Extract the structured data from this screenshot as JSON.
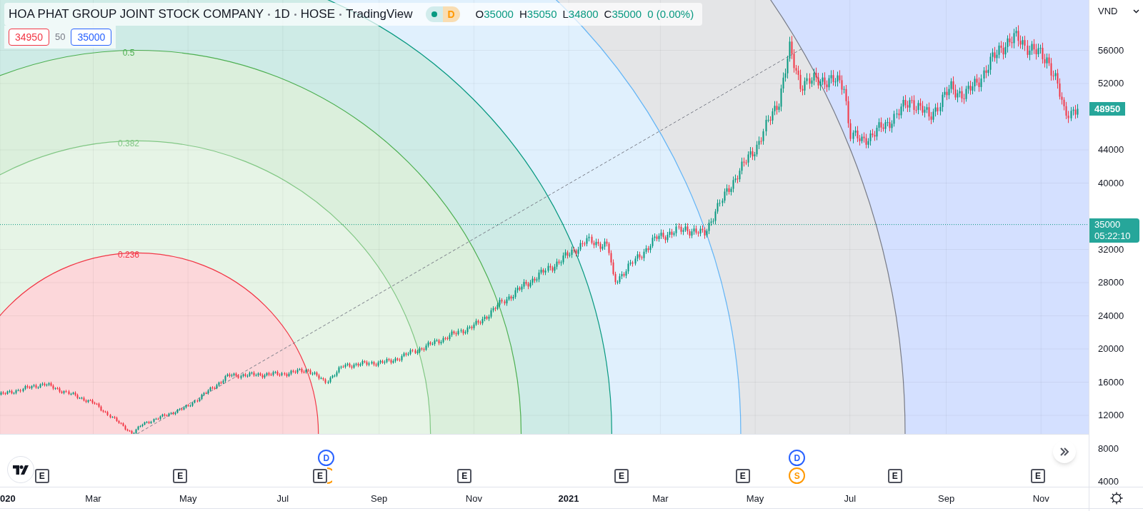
{
  "header": {
    "title": "HOA PHAT GROUP JOINT STOCK COMPANY",
    "interval": "1D",
    "exchange": "HOSE",
    "source": "TradingView",
    "session_badge": "D",
    "ohlc": [
      {
        "key": "O",
        "value": "35000"
      },
      {
        "key": "H",
        "value": "35050"
      },
      {
        "key": "L",
        "value": "34800"
      },
      {
        "key": "C",
        "value": "35000"
      }
    ],
    "change": "0 (0.00%)"
  },
  "quote": {
    "sell": "34950",
    "spread": "50",
    "buy": "35000"
  },
  "fib_labels": [
    "0.5",
    "0.382",
    "0.236"
  ],
  "price_axis": [
    "56000",
    "52000",
    "44000",
    "40000",
    "32000",
    "28000",
    "24000",
    "20000",
    "16000",
    "12000",
    "8000",
    "4000"
  ],
  "time_axis": [
    {
      "label": "020",
      "kind": "year"
    },
    {
      "label": "Mar",
      "kind": "month"
    },
    {
      "label": "May",
      "kind": "month"
    },
    {
      "label": "Jul",
      "kind": "month"
    },
    {
      "label": "Sep",
      "kind": "month"
    },
    {
      "label": "Nov",
      "kind": "month"
    },
    {
      "label": "2021",
      "kind": "year"
    },
    {
      "label": "Mar",
      "kind": "month"
    },
    {
      "label": "May",
      "kind": "month"
    },
    {
      "label": "Jul",
      "kind": "month"
    },
    {
      "label": "Sep",
      "kind": "month"
    },
    {
      "label": "Nov",
      "kind": "month"
    }
  ],
  "last_price": "48950",
  "current_price": {
    "price": "35000",
    "countdown": "05:22:10"
  },
  "currency": "VND",
  "events": [
    {
      "kind": "earnings",
      "label": "E"
    },
    {
      "kind": "earnings",
      "label": "E"
    },
    {
      "kind": "split"
    },
    {
      "kind": "earnings",
      "label": "E"
    },
    {
      "kind": "dividend",
      "label": "D"
    },
    {
      "kind": "earnings",
      "label": "E"
    },
    {
      "kind": "earnings",
      "label": "E"
    },
    {
      "kind": "earnings",
      "label": "E"
    },
    {
      "kind": "dividend",
      "label": "D"
    },
    {
      "kind": "split",
      "label": "S"
    },
    {
      "kind": "earnings",
      "label": "E"
    },
    {
      "kind": "earnings",
      "label": "E"
    }
  ]
}
